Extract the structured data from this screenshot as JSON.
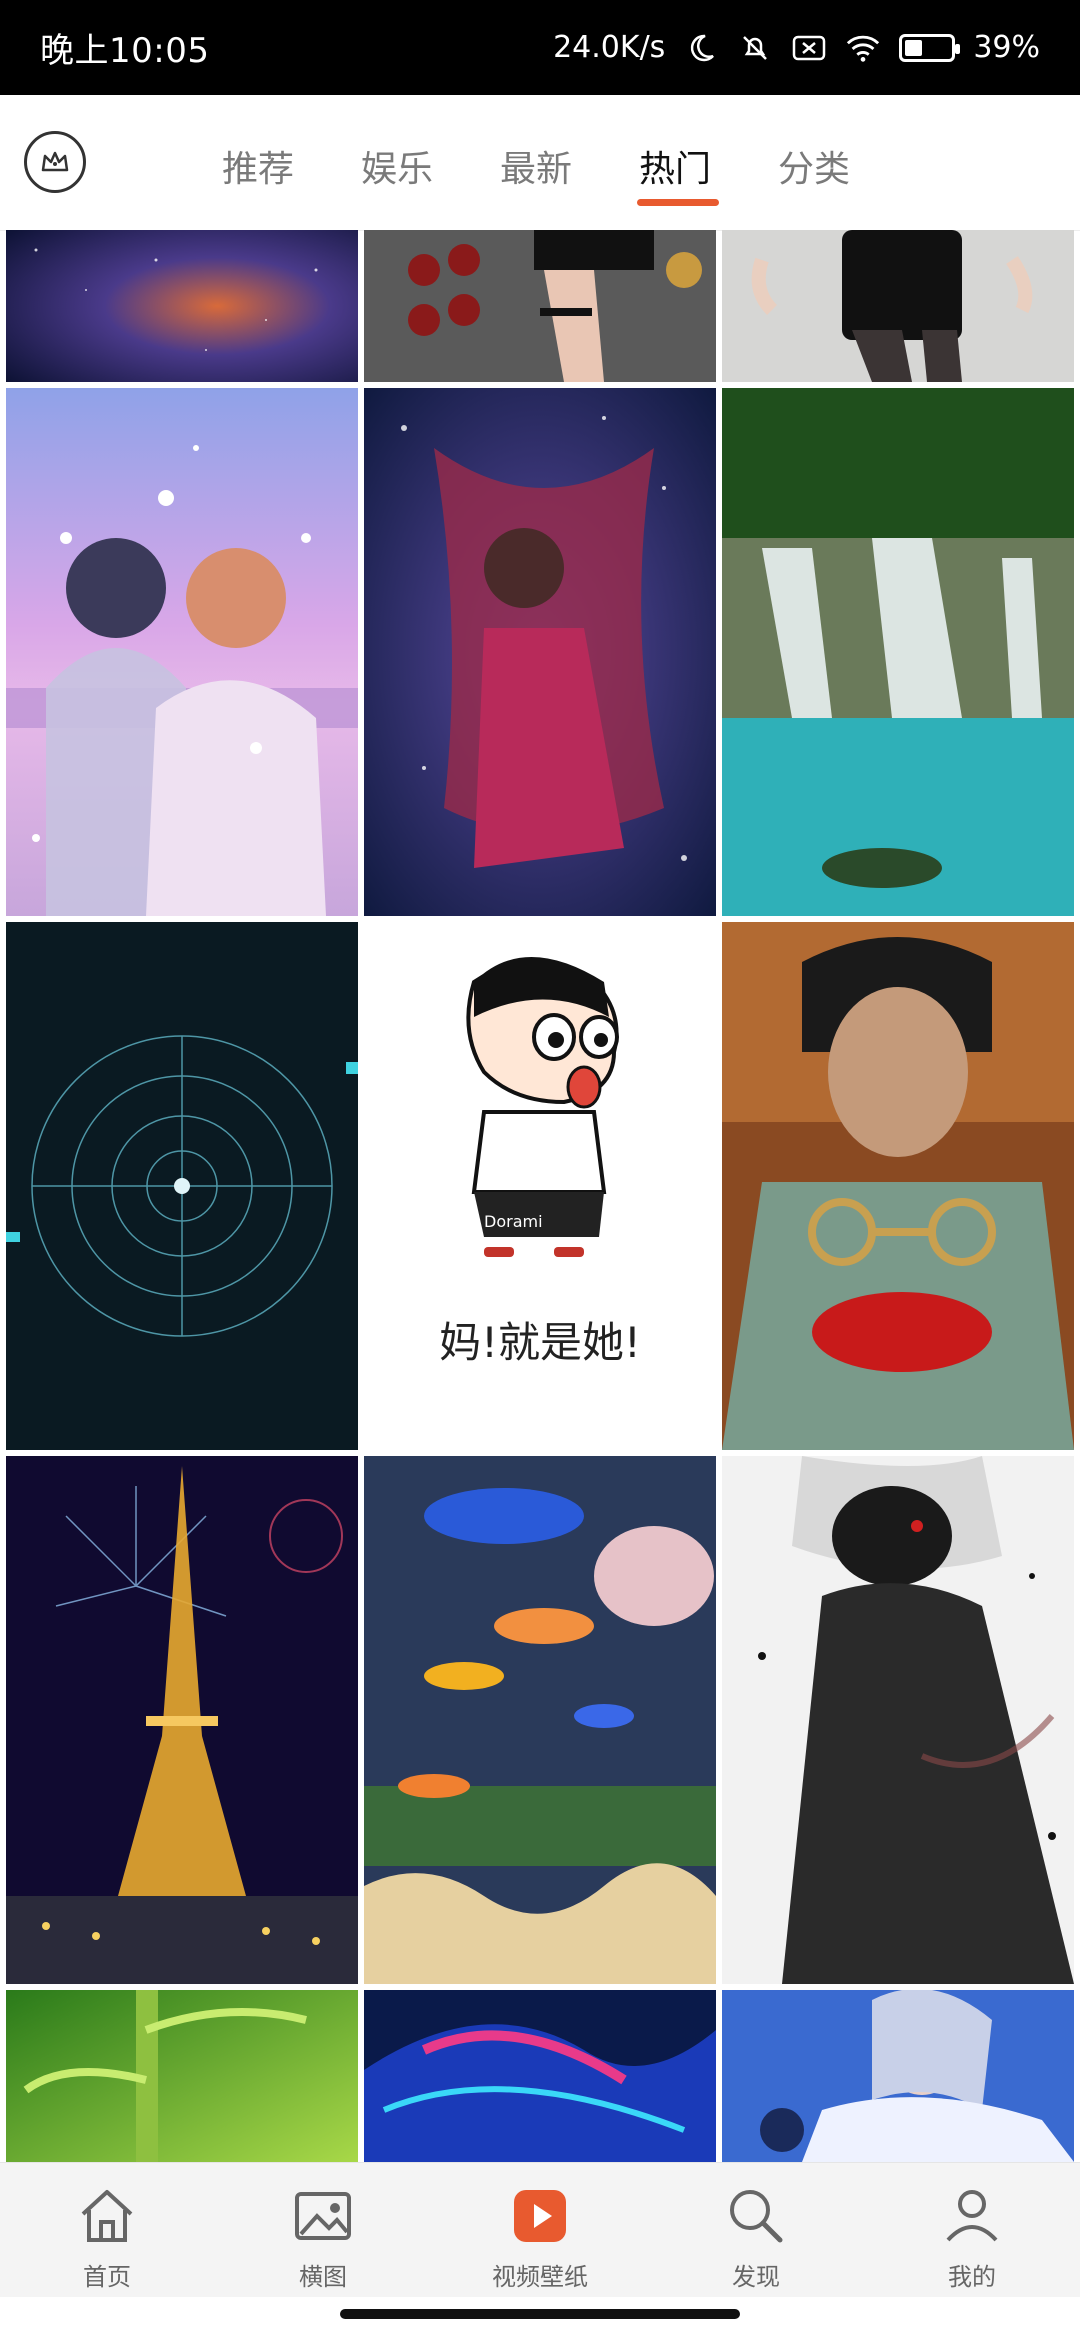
{
  "status_bar": {
    "time": "晚上10:05",
    "net_speed": "24.0K/s",
    "battery_text": "39%",
    "battery_level": 0.39
  },
  "top_nav": {
    "tabs": [
      {
        "label": "推荐",
        "active": false
      },
      {
        "label": "娱乐",
        "active": false
      },
      {
        "label": "最新",
        "active": false
      },
      {
        "label": "热门",
        "active": true
      },
      {
        "label": "分类",
        "active": false
      }
    ],
    "accent_color": "#e85a2f"
  },
  "grid": {
    "tiles": [
      {
        "name": "tile-galaxy"
      },
      {
        "name": "tile-legs-dark"
      },
      {
        "name": "tile-legs-light"
      },
      {
        "name": "tile-couple-sparkles"
      },
      {
        "name": "tile-anime-girl"
      },
      {
        "name": "tile-waterfall"
      },
      {
        "name": "tile-tech-circle"
      },
      {
        "name": "tile-crayon-shin",
        "caption": "妈!就是她!",
        "shirt_text": "Dorami"
      },
      {
        "name": "tile-man-glasses"
      },
      {
        "name": "tile-eiffel-fireworks"
      },
      {
        "name": "tile-aquarium-fish"
      },
      {
        "name": "tile-masked-anime"
      },
      {
        "name": "tile-bamboo"
      },
      {
        "name": "tile-anime-hair"
      },
      {
        "name": "tile-fantasy-warrior"
      }
    ]
  },
  "bottom_nav": {
    "items": [
      {
        "label": "首页",
        "icon": "home-icon",
        "active": false
      },
      {
        "label": "横图",
        "icon": "image-icon",
        "active": false
      },
      {
        "label": "视频壁纸",
        "icon": "video-play-icon",
        "active": true
      },
      {
        "label": "发现",
        "icon": "search-icon",
        "active": false
      },
      {
        "label": "我的",
        "icon": "profile-icon",
        "active": false
      }
    ]
  }
}
